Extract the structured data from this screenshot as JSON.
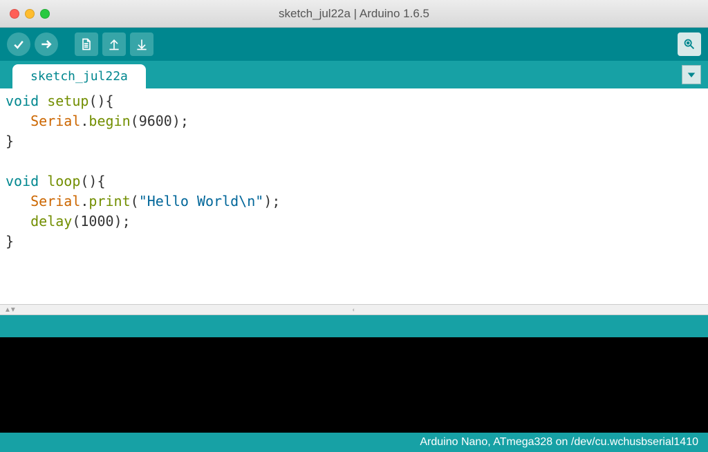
{
  "window": {
    "title": "sketch_jul22a | Arduino 1.6.5"
  },
  "tabs": {
    "active": "sketch_jul22a"
  },
  "code": {
    "tokens": [
      [
        {
          "t": "kw",
          "v": "void"
        },
        {
          "t": "pln",
          "v": " "
        },
        {
          "t": "fn",
          "v": "setup"
        },
        {
          "t": "pln",
          "v": "(){"
        }
      ],
      [
        {
          "t": "pln",
          "v": "   "
        },
        {
          "t": "cls",
          "v": "Serial"
        },
        {
          "t": "pln",
          "v": "."
        },
        {
          "t": "fn",
          "v": "begin"
        },
        {
          "t": "pln",
          "v": "("
        },
        {
          "t": "num",
          "v": "9600"
        },
        {
          "t": "pln",
          "v": ");"
        }
      ],
      [
        {
          "t": "pln",
          "v": "}"
        }
      ],
      [
        {
          "t": "pln",
          "v": ""
        }
      ],
      [
        {
          "t": "kw",
          "v": "void"
        },
        {
          "t": "pln",
          "v": " "
        },
        {
          "t": "fn",
          "v": "loop"
        },
        {
          "t": "pln",
          "v": "(){"
        }
      ],
      [
        {
          "t": "pln",
          "v": "   "
        },
        {
          "t": "cls",
          "v": "Serial"
        },
        {
          "t": "pln",
          "v": "."
        },
        {
          "t": "fn",
          "v": "print"
        },
        {
          "t": "pln",
          "v": "("
        },
        {
          "t": "str",
          "v": "\"Hello World\\n\""
        },
        {
          "t": "pln",
          "v": ");"
        }
      ],
      [
        {
          "t": "pln",
          "v": "   "
        },
        {
          "t": "fn",
          "v": "delay"
        },
        {
          "t": "pln",
          "v": "("
        },
        {
          "t": "num",
          "v": "1000"
        },
        {
          "t": "pln",
          "v": ");"
        }
      ],
      [
        {
          "t": "pln",
          "v": "}"
        }
      ]
    ]
  },
  "status": {
    "text": "Arduino Nano, ATmega328 on /dev/cu.wchusbserial1410"
  },
  "colors": {
    "toolbar": "#00878F",
    "accent": "#17A1A5",
    "button": "#37A5A8"
  }
}
